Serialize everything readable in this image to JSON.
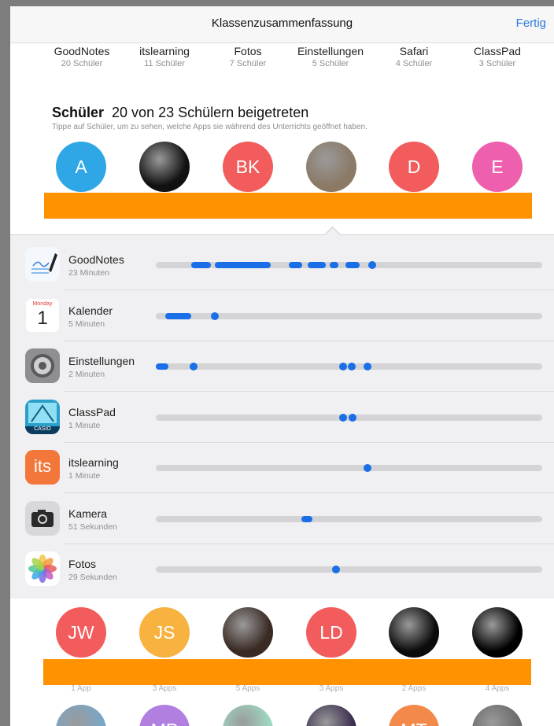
{
  "navbar": {
    "title": "Klassenzusammenfassung",
    "done": "Fertig"
  },
  "apps": [
    {
      "name": "GoodNotes",
      "count": "20 Schüler"
    },
    {
      "name": "itslearning",
      "count": "11 Schüler"
    },
    {
      "name": "Fotos",
      "count": "7 Schüler"
    },
    {
      "name": "Einstellungen",
      "count": "5 Schüler"
    },
    {
      "name": "Safari",
      "count": "4 Schüler"
    },
    {
      "name": "ClassPad",
      "count": "3 Schüler"
    }
  ],
  "students": {
    "heading": "Schüler",
    "joined": "20 von 23 Schülern beigetreten",
    "hint": "Tippe auf Schüler, um zu sehen, welche Apps sie während des Unterrichts geöffnet haben.",
    "row1": [
      {
        "initials": "A",
        "color": "#2fa7e6"
      },
      {
        "initials": "",
        "color": "#111111"
      },
      {
        "initials": "BK",
        "color": "#f25c5c"
      },
      {
        "initials": "",
        "color": "#8a7a66"
      },
      {
        "initials": "D",
        "color": "#f25c5c"
      },
      {
        "initials": "E",
        "color": "#ee5fae"
      }
    ],
    "row2": [
      {
        "initials": "JW",
        "color": "#f25c5c",
        "apps": "1 App"
      },
      {
        "initials": "JS",
        "color": "#f7b23f",
        "apps": "3 Apps"
      },
      {
        "initials": "",
        "color": "#3a2a24",
        "apps": "5 Apps"
      },
      {
        "initials": "LD",
        "color": "#f25c5c",
        "apps": "3 Apps"
      },
      {
        "initials": "",
        "color": "#0b0b0b",
        "apps": "2 Apps"
      },
      {
        "initials": "",
        "color": "#000000",
        "apps": "4 Apps"
      }
    ],
    "row3": [
      {
        "initials": "",
        "color": "#7aa6c8"
      },
      {
        "initials": "MP",
        "color": "#b07fe0"
      },
      {
        "initials": "",
        "color": "#9fd8c2"
      },
      {
        "initials": "",
        "color": "#3d2f4f"
      },
      {
        "initials": "MT",
        "color": "#f38a4a"
      },
      {
        "initials": "",
        "color": "#6a6a6a"
      }
    ]
  },
  "usage": [
    {
      "app": "GoodNotes",
      "time": "23 Minuten",
      "icon": "goodnotes-icon",
      "segments": [
        [
          0.092,
          0.142
        ],
        [
          0.153,
          0.298
        ],
        [
          0.345,
          0.378
        ],
        [
          0.394,
          0.44
        ],
        [
          0.45,
          0.473
        ],
        [
          0.49,
          0.528
        ]
      ],
      "dots": [
        0.561
      ]
    },
    {
      "app": "Kalender",
      "time": "5 Minuten",
      "icon": "calendar-icon",
      "icon_month": "Monday",
      "icon_day": "1",
      "segments": [
        [
          0.025,
          0.092
        ]
      ],
      "dots": [
        0.153
      ]
    },
    {
      "app": "Einstellungen",
      "time": "2 Minuten",
      "icon": "settings-icon",
      "segments": [
        [
          0.0,
          0.032
        ]
      ],
      "dots": [
        0.098,
        0.484,
        0.508,
        0.547
      ]
    },
    {
      "app": "ClassPad",
      "time": "1 Minute",
      "icon": "classpad-icon",
      "icon_label": "CASIO",
      "segments": [],
      "dots": [
        0.484,
        0.51
      ]
    },
    {
      "app": "itslearning",
      "time": "1 Minute",
      "icon": "itslearning-icon",
      "icon_label": "its",
      "segments": [],
      "dots": [
        0.547
      ]
    },
    {
      "app": "Kamera",
      "time": "51 Sekunden",
      "icon": "camera-icon",
      "segments": [
        [
          0.376,
          0.405
        ]
      ],
      "dots": []
    },
    {
      "app": "Fotos",
      "time": "29 Sekunden",
      "icon": "photos-icon",
      "segments": [],
      "dots": [
        0.467
      ]
    }
  ],
  "colors": {
    "accent": "#2a7ae2",
    "usage_bar": "#1a6fe6",
    "redaction": "#ff9200"
  }
}
